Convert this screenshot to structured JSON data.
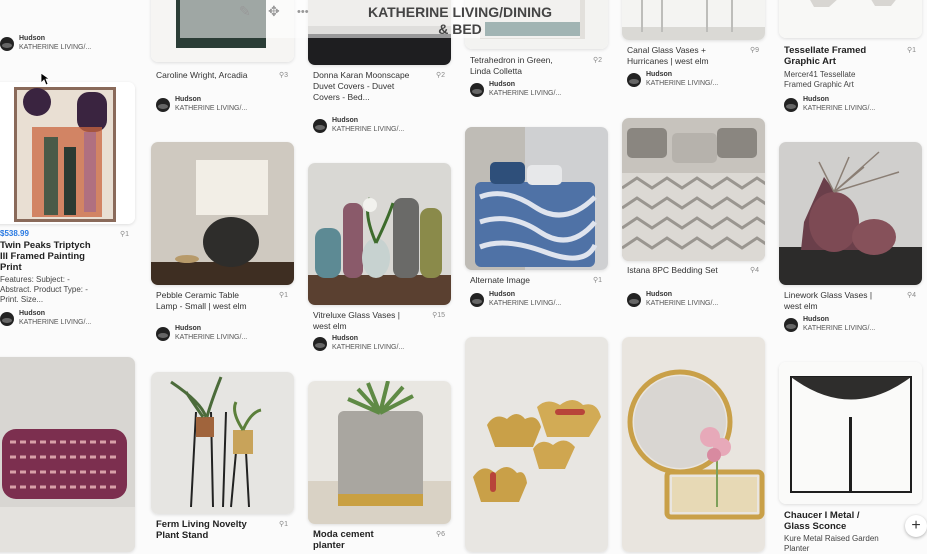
{
  "board": {
    "title": "KATHERINE LIVING/DINING & BED",
    "title_line1": "KATHERINE LIVING/DINING",
    "title_line2": "& BED"
  },
  "toolbar": {
    "edit_icon": "pencil-icon",
    "move_icon": "move-icon",
    "more_icon": "more-icon",
    "edit_glyph": "✎",
    "move_glyph": "✥",
    "more_glyph": "•••"
  },
  "add_button": {
    "icon": "plus-icon",
    "glyph": "+"
  },
  "attribution": {
    "user": "Hudson",
    "board_name": "KATHERINE LIVING/..."
  },
  "pins": {
    "c0": [
      {
        "title": "Twin Peaks Triptych III Framed Painting Print",
        "price": "$538.99",
        "desc": "Features: Subject: - Abstract. Product Type: -Print. Size...",
        "count": "1"
      },
      {
        "title": ""
      }
    ],
    "c1": [
      {
        "title": "Caroline Wright, Arcadia",
        "count": "3"
      },
      {
        "title": "Pebble Ceramic Table Lamp - Small | west elm",
        "count": "1"
      },
      {
        "title": "Ferm Living Novelty Plant Stand",
        "count": "1"
      }
    ],
    "c2": [
      {
        "title": "Donna Karan Moonscape Duvet Covers - Duvet Covers - Bed...",
        "count": "2"
      },
      {
        "title": "Vitreluxe Glass Vases | west elm",
        "count": "15"
      },
      {
        "title": "Moda cement planter",
        "count": "6"
      }
    ],
    "c3": [
      {
        "title": "Tetrahedron in Green, Linda Colletta",
        "count": "2"
      },
      {
        "title": "Alternate Image",
        "count": "1"
      }
    ],
    "c4": [
      {
        "title": "Canal Glass Vases + Hurricanes | west elm",
        "count": "9"
      },
      {
        "title": "Istana 8PC Bedding Set",
        "count": "4"
      }
    ],
    "c5": [
      {
        "title": "Tessellate Framed Graphic Art",
        "desc": "Mercer41 Tessellate Framed Graphic Art",
        "count": "1"
      },
      {
        "title": "Linework Glass Vases | west elm",
        "count": "4"
      },
      {
        "title": "Chaucer I Metal / Glass Sconce",
        "desc": "Kure Metal Raised Garden Planter"
      }
    ]
  },
  "colors": {
    "accent_price": "#2a7ae2",
    "background": "#fbfbfb"
  }
}
